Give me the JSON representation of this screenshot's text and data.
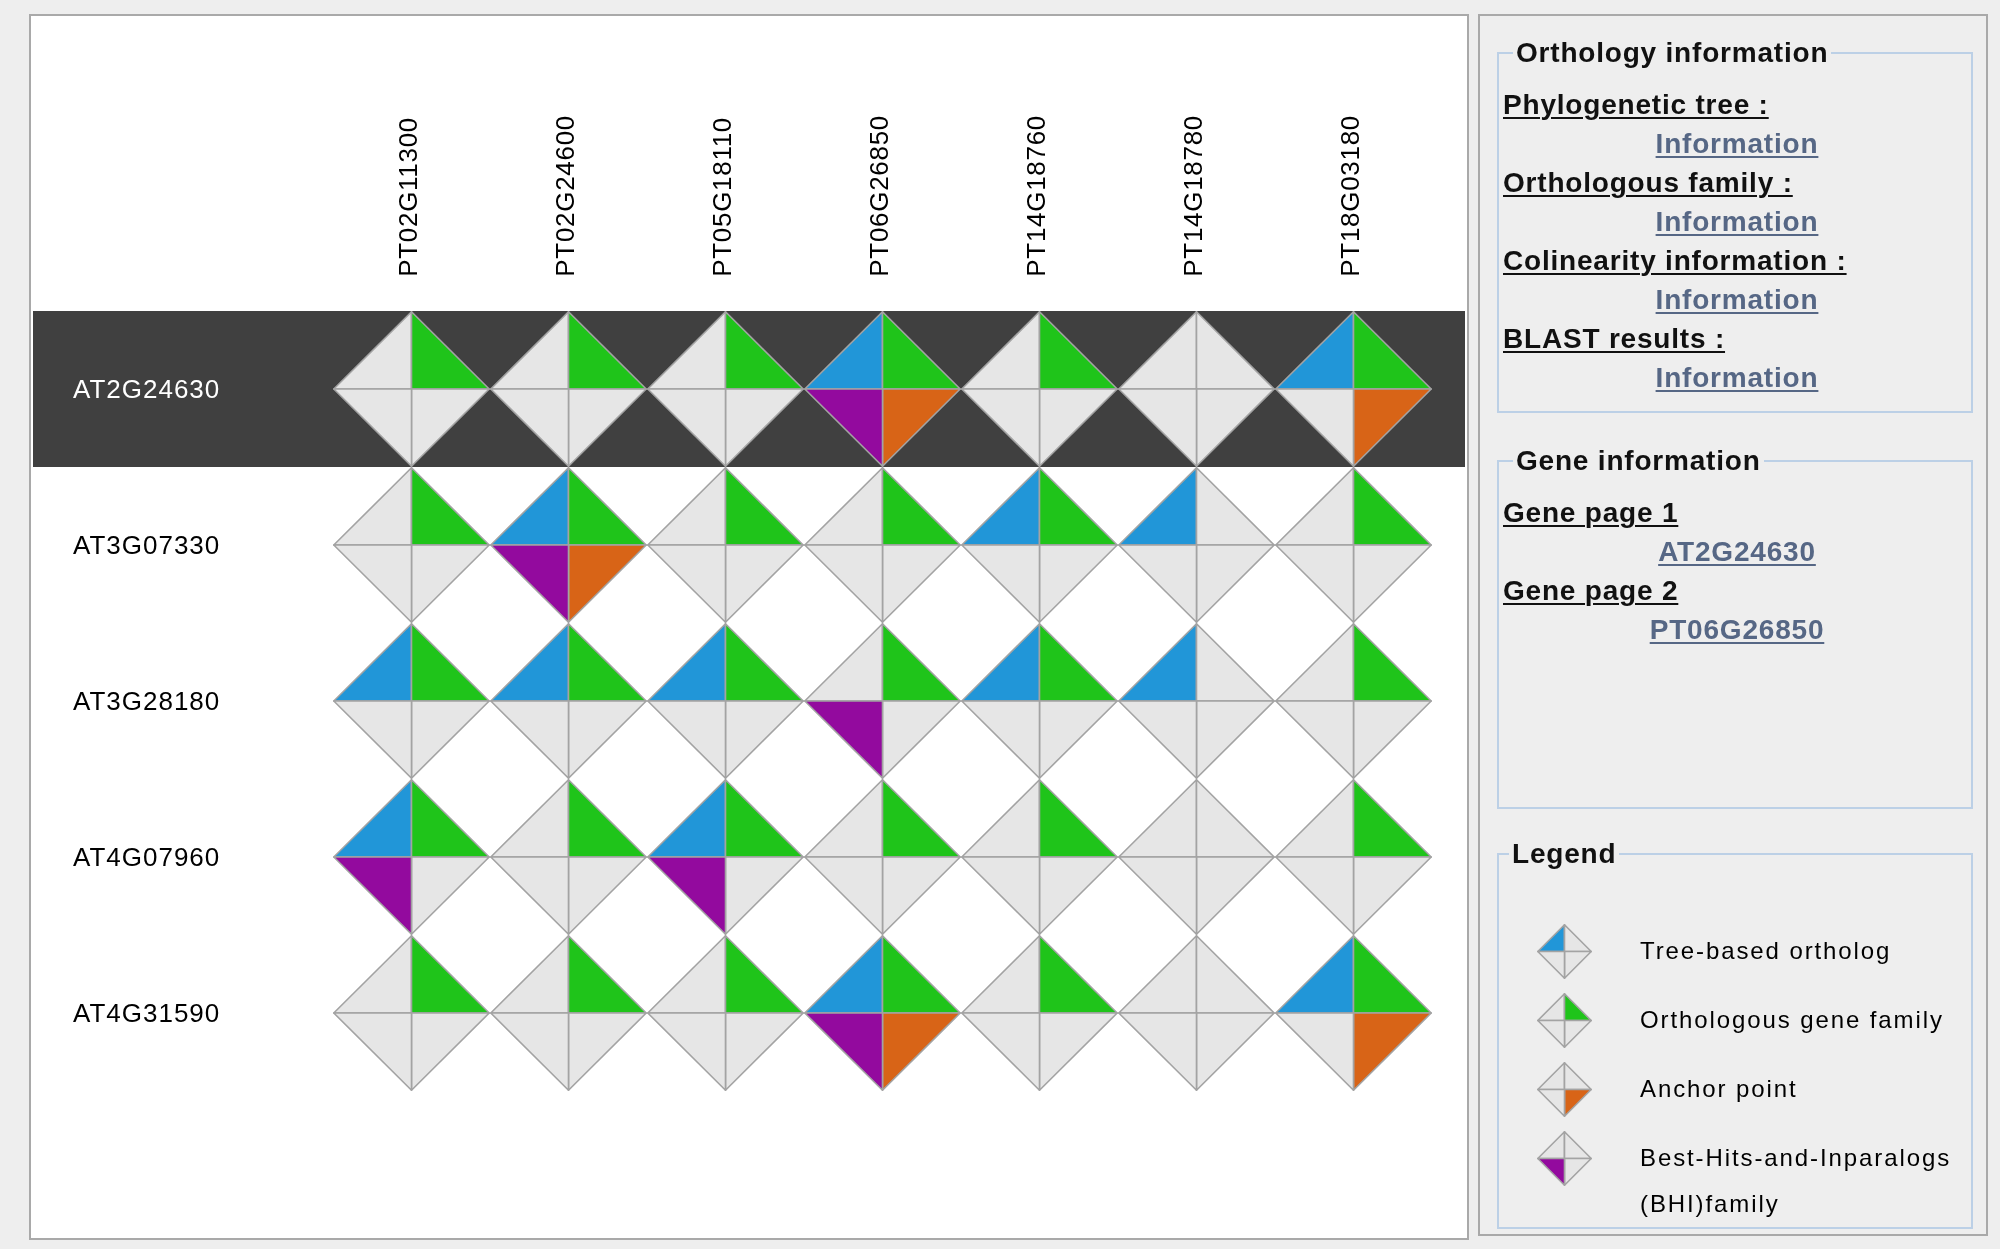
{
  "matrix": {
    "columns": [
      "PT02G11300",
      "PT02G24600",
      "PT05G18110",
      "PT06G26850",
      "PT14G18760",
      "PT14G18780",
      "PT18G03180"
    ],
    "rows": [
      {
        "label": "AT2G24630",
        "selected": true,
        "cells": [
          {
            "tree": false,
            "family": true,
            "anchor": false,
            "bhi": false
          },
          {
            "tree": false,
            "family": true,
            "anchor": false,
            "bhi": false
          },
          {
            "tree": false,
            "family": true,
            "anchor": false,
            "bhi": false
          },
          {
            "tree": true,
            "family": true,
            "anchor": true,
            "bhi": true
          },
          {
            "tree": false,
            "family": true,
            "anchor": false,
            "bhi": false
          },
          {
            "tree": false,
            "family": false,
            "anchor": false,
            "bhi": false
          },
          {
            "tree": true,
            "family": true,
            "anchor": true,
            "bhi": false
          }
        ]
      },
      {
        "label": "AT3G07330",
        "selected": false,
        "cells": [
          {
            "tree": false,
            "family": true,
            "anchor": false,
            "bhi": false
          },
          {
            "tree": true,
            "family": true,
            "anchor": true,
            "bhi": true
          },
          {
            "tree": false,
            "family": true,
            "anchor": false,
            "bhi": false
          },
          {
            "tree": false,
            "family": true,
            "anchor": false,
            "bhi": false
          },
          {
            "tree": true,
            "family": true,
            "anchor": false,
            "bhi": false
          },
          {
            "tree": true,
            "family": false,
            "anchor": false,
            "bhi": false
          },
          {
            "tree": false,
            "family": true,
            "anchor": false,
            "bhi": false
          }
        ]
      },
      {
        "label": "AT3G28180",
        "selected": false,
        "cells": [
          {
            "tree": true,
            "family": true,
            "anchor": false,
            "bhi": false
          },
          {
            "tree": true,
            "family": true,
            "anchor": false,
            "bhi": false
          },
          {
            "tree": true,
            "family": true,
            "anchor": false,
            "bhi": false
          },
          {
            "tree": false,
            "family": true,
            "anchor": false,
            "bhi": true
          },
          {
            "tree": true,
            "family": true,
            "anchor": false,
            "bhi": false
          },
          {
            "tree": true,
            "family": false,
            "anchor": false,
            "bhi": false
          },
          {
            "tree": false,
            "family": true,
            "anchor": false,
            "bhi": false
          }
        ]
      },
      {
        "label": "AT4G07960",
        "selected": false,
        "cells": [
          {
            "tree": true,
            "family": true,
            "anchor": false,
            "bhi": true
          },
          {
            "tree": false,
            "family": true,
            "anchor": false,
            "bhi": false
          },
          {
            "tree": true,
            "family": true,
            "anchor": false,
            "bhi": true
          },
          {
            "tree": false,
            "family": true,
            "anchor": false,
            "bhi": false
          },
          {
            "tree": false,
            "family": true,
            "anchor": false,
            "bhi": false
          },
          {
            "tree": false,
            "family": false,
            "anchor": false,
            "bhi": false
          },
          {
            "tree": false,
            "family": true,
            "anchor": false,
            "bhi": false
          }
        ]
      },
      {
        "label": "AT4G31590",
        "selected": false,
        "cells": [
          {
            "tree": false,
            "family": true,
            "anchor": false,
            "bhi": false
          },
          {
            "tree": false,
            "family": true,
            "anchor": false,
            "bhi": false
          },
          {
            "tree": false,
            "family": true,
            "anchor": false,
            "bhi": false
          },
          {
            "tree": true,
            "family": true,
            "anchor": true,
            "bhi": true
          },
          {
            "tree": false,
            "family": true,
            "anchor": false,
            "bhi": false
          },
          {
            "tree": false,
            "family": false,
            "anchor": false,
            "bhi": false
          },
          {
            "tree": true,
            "family": true,
            "anchor": true,
            "bhi": false
          }
        ]
      }
    ]
  },
  "orthology_information": {
    "title": "Orthology information",
    "items": [
      {
        "label": "Phylogenetic tree :",
        "link": "Information"
      },
      {
        "label": "Orthologous family :",
        "link": "Information"
      },
      {
        "label": "Colinearity information :",
        "link": "Information"
      },
      {
        "label": "BLAST results :",
        "link": "Information"
      }
    ]
  },
  "gene_information": {
    "title": "Gene information",
    "items": [
      {
        "label": "Gene page 1",
        "link": "AT2G24630"
      },
      {
        "label": "Gene page 2",
        "link": "PT06G26850"
      }
    ]
  },
  "legend": {
    "title": "Legend",
    "items": [
      {
        "kind": "tree",
        "label": "Tree-based ortholog"
      },
      {
        "kind": "family",
        "label": "Orthologous gene family"
      },
      {
        "kind": "anchor",
        "label": "Anchor point"
      },
      {
        "kind": "bhi",
        "label": "Best-Hits-and-Inparalogs (BHI)family"
      }
    ]
  }
}
